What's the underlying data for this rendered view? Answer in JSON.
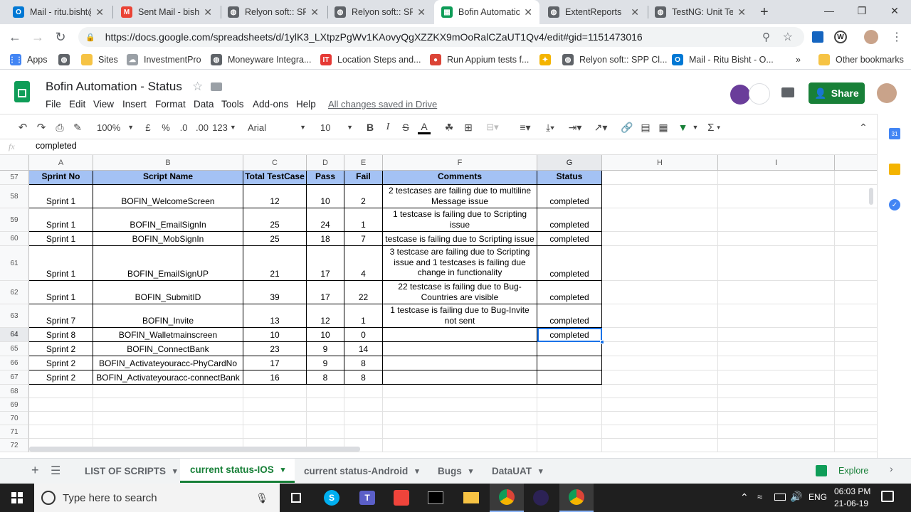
{
  "browser": {
    "tabs": [
      {
        "title": "Mail - ritu.bisht@",
        "icon": "outlook-icon",
        "color": "#0078d4",
        "glyph": "O"
      },
      {
        "title": "Sent Mail - bisht",
        "icon": "gmail-icon",
        "color": "#ea4335",
        "glyph": "M"
      },
      {
        "title": "Relyon soft:: SPP",
        "icon": "globe-icon",
        "color": "#5f6368",
        "glyph": "◍"
      },
      {
        "title": "Relyon soft:: SPP",
        "icon": "globe-icon",
        "color": "#5f6368",
        "glyph": "◍"
      },
      {
        "title": "Bofin Automatio",
        "icon": "sheets-icon",
        "color": "#0f9d58",
        "glyph": "▦"
      },
      {
        "title": "ExtentReports",
        "icon": "globe-icon",
        "color": "#5f6368",
        "glyph": "◍"
      },
      {
        "title": "TestNG: Unit Tes",
        "icon": "globe-icon",
        "color": "#5f6368",
        "glyph": "◍"
      }
    ],
    "url": "https://docs.google.com/spreadsheets/d/1ylK3_LXtpzPgWv1KAovyQgXZZKX9mOoRalCZaUT1Qv4/edit#gid=1151473016",
    "bookmarks": [
      {
        "label": "Apps",
        "icon": "apps-icon",
        "color": "#4285f4",
        "glyph": "⋮⋮"
      },
      {
        "label": "",
        "icon": "globe-icon",
        "color": "#5f6368",
        "glyph": "◍"
      },
      {
        "label": "Sites",
        "icon": "folder-icon",
        "color": "#f6c344",
        "glyph": ""
      },
      {
        "label": "InvestmentPro",
        "icon": "cloud-icon",
        "color": "#9aa0a6",
        "glyph": "☁"
      },
      {
        "label": "Moneyware Integra...",
        "icon": "globe-icon",
        "color": "#5f6368",
        "glyph": "◍"
      },
      {
        "label": "Location Steps and...",
        "icon": "it-icon",
        "color": "#e53935",
        "glyph": "IT"
      },
      {
        "label": "Run Appium tests f...",
        "icon": "chrome-icon",
        "color": "#db4437",
        "glyph": "●"
      },
      {
        "label": "",
        "icon": "star-icon",
        "color": "#f4b400",
        "glyph": "✦"
      },
      {
        "label": "Relyon soft:: SPP Cl...",
        "icon": "globe-icon",
        "color": "#5f6368",
        "glyph": "◍"
      },
      {
        "label": "Mail - Ritu Bisht - O...",
        "icon": "outlook-icon",
        "color": "#0078d4",
        "glyph": "O"
      }
    ],
    "more_bookmarks": "»",
    "other_bookmarks": "Other bookmarks"
  },
  "sheets": {
    "title": "Bofin Automation - Status",
    "menus": [
      "File",
      "Edit",
      "View",
      "Insert",
      "Format",
      "Data",
      "Tools",
      "Add-ons",
      "Help"
    ],
    "saved_status": "All changes saved in Drive",
    "share_label": "Share",
    "toolbar": {
      "zoom": "100%",
      "currency": "£",
      "percent": "%",
      "dec_less": ".0",
      "dec_more": ".00",
      "more_formats": "123",
      "font": "Arial",
      "font_size": "10"
    },
    "formula_bar": {
      "label": "fx",
      "value": "completed"
    },
    "columns": [
      "A",
      "B",
      "C",
      "D",
      "E",
      "F",
      "G",
      "H",
      "I"
    ],
    "rows": [
      {
        "num": "57",
        "cells": [
          "Sprint No",
          "Script Name",
          "Total TestCase",
          "Pass",
          "Fail",
          "Comments",
          "Status"
        ]
      },
      {
        "num": "58",
        "cells": [
          "Sprint 1",
          "BOFIN_WelcomeScreen",
          "12",
          "10",
          "2",
          "2 testcases are failing due to multiline Message issue",
          "completed"
        ]
      },
      {
        "num": "59",
        "cells": [
          "Sprint 1",
          "BOFIN_EmailSignIn",
          "25",
          "24",
          "1",
          "1 testcase is failing due to Scripting issue",
          "completed"
        ]
      },
      {
        "num": "60",
        "cells": [
          "Sprint 1",
          "BOFIN_MobSignIn",
          "25",
          "18",
          "7",
          "testcase is failing due to Scripting issue",
          "completed"
        ]
      },
      {
        "num": "61",
        "cells": [
          "Sprint 1",
          "BOFIN_EmailSignUP",
          "21",
          "17",
          "4",
          "3 testcase are failing due to Scripting issue and 1 testcases is failing due change in functionality",
          "completed"
        ]
      },
      {
        "num": "62",
        "cells": [
          "Sprint 1",
          "BOFIN_SubmitID",
          "39",
          "17",
          "22",
          "22 testcase is failing due to Bug-Countries are visible",
          "completed"
        ]
      },
      {
        "num": "63",
        "cells": [
          "Sprint 7",
          "BOFIN_Invite",
          "13",
          "12",
          "1",
          "1 testcase is failing due to Bug-Invite not sent",
          "completed"
        ]
      },
      {
        "num": "64",
        "cells": [
          "Sprint 8",
          "BOFIN_Walletmainscreen",
          "10",
          "10",
          "0",
          "",
          "completed"
        ]
      },
      {
        "num": "65",
        "cells": [
          "Sprint 2",
          "BOFIN_ConnectBank",
          "23",
          "9",
          "14",
          "",
          ""
        ]
      },
      {
        "num": "66",
        "cells": [
          "Sprint 2",
          "BOFIN_Activateyouracc-PhyCardNo",
          "17",
          "9",
          "8",
          "",
          ""
        ]
      },
      {
        "num": "67",
        "cells": [
          "Sprint 2",
          "BOFIN_Activateyouracc-connectBank",
          "16",
          "8",
          "8",
          "",
          ""
        ]
      },
      {
        "num": "68",
        "cells": []
      },
      {
        "num": "69",
        "cells": []
      },
      {
        "num": "70",
        "cells": []
      },
      {
        "num": "71",
        "cells": []
      },
      {
        "num": "72",
        "cells": []
      }
    ],
    "sheet_tabs": [
      "LIST OF SCRIPTS",
      "current status-IOS",
      "current status-Android",
      "Bugs",
      "DataUAT"
    ],
    "active_sheet": "current status-IOS",
    "explore_label": "Explore"
  },
  "taskbar": {
    "search_placeholder": "Type here to search",
    "language": "ENG",
    "time": "06:03 PM",
    "date": "21-06-19"
  },
  "colors": {
    "header_fill": "#a4c2f4",
    "accent": "#188038",
    "selection": "#1a73e8"
  }
}
